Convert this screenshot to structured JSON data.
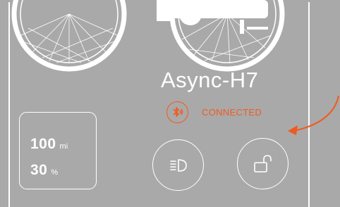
{
  "bike": {
    "model_name": "Async-H7"
  },
  "connection": {
    "icon": "bluetooth-icon",
    "status_text": "CONNECTED",
    "accent_color": "#f05a1e"
  },
  "stats": {
    "range_value": "100",
    "range_unit": "mi",
    "battery_value": "30",
    "battery_unit": "%"
  },
  "controls": {
    "light_icon": "headlight-icon",
    "lock_icon": "unlock-icon"
  },
  "colors": {
    "background": "#a9a9a9",
    "foreground": "#ffffff",
    "accent": "#f05a1e"
  }
}
